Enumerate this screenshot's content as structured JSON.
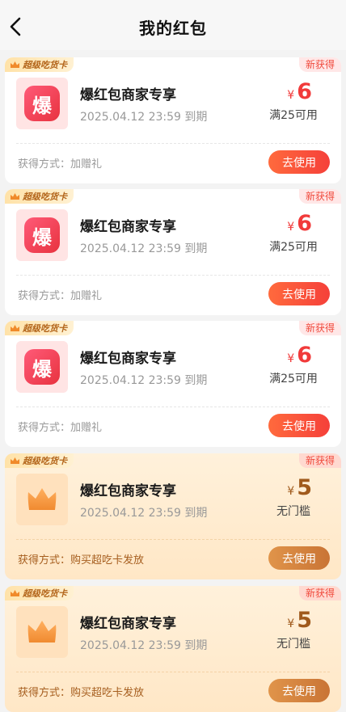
{
  "header": {
    "title": "我的红包"
  },
  "coupons": [
    {
      "tag": "超级吃货卡",
      "badge": "新获得",
      "icon_text": "爆",
      "name": "爆红包商家专享",
      "expiry": "2025.04.12 23:59 到期",
      "currency": "¥",
      "amount": "6",
      "condition": "满25可用",
      "method": "获得方式：加赠礼",
      "button": "去使用"
    },
    {
      "tag": "超级吃货卡",
      "badge": "新获得",
      "icon_text": "爆",
      "name": "爆红包商家专享",
      "expiry": "2025.04.12 23:59 到期",
      "currency": "¥",
      "amount": "6",
      "condition": "满25可用",
      "method": "获得方式：加赠礼",
      "button": "去使用"
    },
    {
      "tag": "超级吃货卡",
      "badge": "新获得",
      "icon_text": "爆",
      "name": "爆红包商家专享",
      "expiry": "2025.04.12 23:59 到期",
      "currency": "¥",
      "amount": "6",
      "condition": "满25可用",
      "method": "获得方式：加赠礼",
      "button": "去使用"
    },
    {
      "tag": "超级吃货卡",
      "badge": "新获得",
      "name": "爆红包商家专享",
      "expiry": "2025.04.12 23:59 到期",
      "currency": "¥",
      "amount": "5",
      "condition": "无门槛",
      "method": "获得方式：购买超吃卡发放",
      "button": "去使用"
    },
    {
      "tag": "超级吃货卡",
      "badge": "新获得",
      "name": "爆红包商家专享",
      "expiry": "2025.04.12 23:59 到期",
      "currency": "¥",
      "amount": "5",
      "condition": "无门槛",
      "method": "获得方式：购买超吃卡发放",
      "button": "去使用"
    }
  ],
  "colors": {
    "red_accent": "#f13a3a",
    "gold_accent": "#a05a1c",
    "background": "#f3f3f3"
  }
}
